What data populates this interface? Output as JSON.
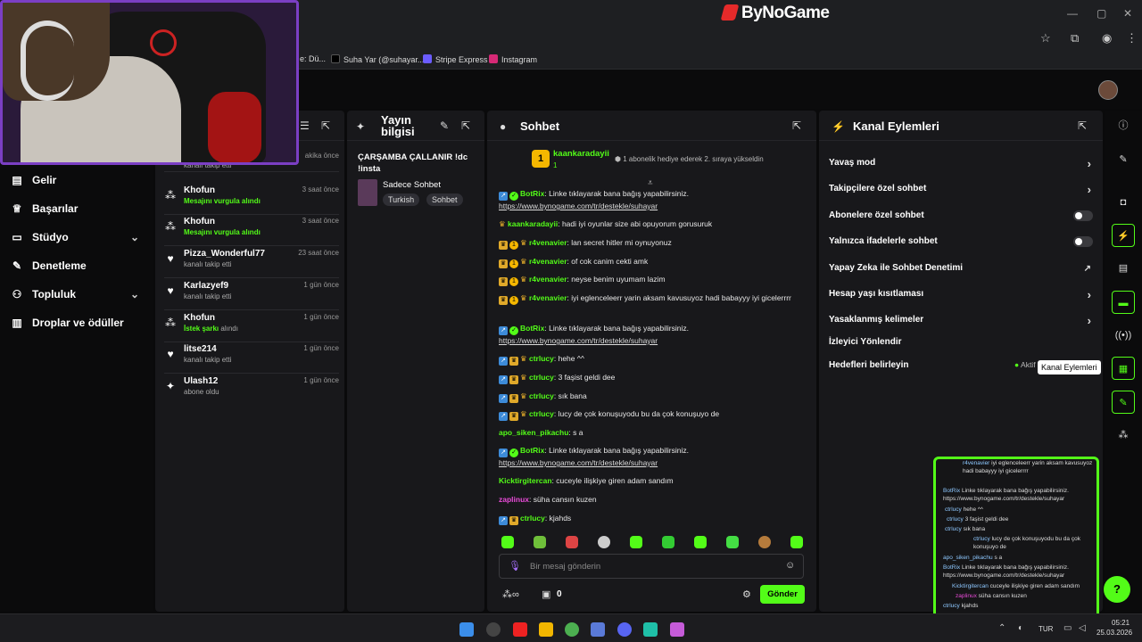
{
  "browser": {
    "brand": "ByNoGame",
    "bookmarks": [
      {
        "label": "e: Dü..."
      },
      {
        "label": "Suha Yar (@suhayar...",
        "icon": "tiktok-icon"
      },
      {
        "label": "Stripe Express",
        "icon": "stripe-icon"
      },
      {
        "label": "Instagram",
        "icon": "instagram-icon"
      }
    ]
  },
  "sidebar": {
    "items": [
      {
        "label": "Gelir",
        "icon": "wallet-icon"
      },
      {
        "label": "Başarılar",
        "icon": "trophy-icon"
      },
      {
        "label": "Stüdyo",
        "icon": "studio-icon"
      },
      {
        "label": "Denetleme",
        "icon": "wrench-icon"
      },
      {
        "label": "Topluluk",
        "icon": "people-icon"
      },
      {
        "label": "Droplar ve ödüller",
        "icon": "drops-icon"
      }
    ]
  },
  "events": {
    "partial_top": {
      "time": "akika önce",
      "desc": "kanalı takip etti"
    },
    "items": [
      {
        "name": "Khofun",
        "time": "3 saat önce",
        "desc": "Mesajını vurgula alındı",
        "icon": "points-icon",
        "highlight": true
      },
      {
        "name": "Khofun",
        "time": "3 saat önce",
        "desc": "Mesajını vurgula alındı",
        "icon": "points-icon",
        "highlight": true
      },
      {
        "name": "Pizza_Wonderful77",
        "time": "23 saat önce",
        "desc": "kanalı takip etti",
        "icon": "heart-icon",
        "highlight": false
      },
      {
        "name": "Karlazyef9",
        "time": "1 gün önce",
        "desc": "kanalı takip etti",
        "icon": "heart-icon",
        "highlight": false
      },
      {
        "name": "Khofun",
        "time": "1 gün önce",
        "desc_hl": "İstek şarkı",
        "desc_rest": "alındı",
        "icon": "points-icon",
        "highlight": true
      },
      {
        "name": "litse214",
        "time": "1 gün önce",
        "desc": "kanalı takip etti",
        "icon": "heart-icon",
        "highlight": false
      },
      {
        "name": "Ulash12",
        "time": "1 gün önce",
        "desc": "abone oldu",
        "icon": "sparkle-icon",
        "highlight": false
      }
    ]
  },
  "stream_info": {
    "title": "Yayın bilgisi",
    "stream_title": "ÇARŞAMBA ÇALLANIR !dc !insta",
    "category": "Sadece Sohbet",
    "tags": [
      "Turkish",
      "Sohbet"
    ]
  },
  "chat": {
    "title": "Sohbet",
    "pinned": {
      "user": "kaankaradayii",
      "rank": "1",
      "count": "1",
      "text": "1 abonelik hediye ederek 2. sıraya yükseldin"
    },
    "messages": [
      {
        "user": "BotRix",
        "color": "#53fc18",
        "badges": [
          "blue",
          "ver"
        ],
        "text": "Linke tıklayarak bana bağış yapabilirsiniz.",
        "link": "https://www.bynogame.com/tr/destekle/suhayar"
      },
      {
        "user": "kaankaradayii",
        "color": "#53fc18",
        "badges": [
          "crown"
        ],
        "text": "hadi iyi oyunlar size abi opuyorum gorusuruk"
      },
      {
        "user": "r4venavier",
        "color": "#53fc18",
        "badges": [
          "crown2",
          "gold",
          "crown"
        ],
        "text": "lan secret hitler mi oynuyonuz"
      },
      {
        "user": "r4venavier",
        "color": "#53fc18",
        "badges": [
          "crown2",
          "gold",
          "crown"
        ],
        "text": "of cok canim cekti amk"
      },
      {
        "user": "r4venavier",
        "color": "#53fc18",
        "badges": [
          "crown2",
          "gold",
          "crown"
        ],
        "text": "neyse benim uyumam lazim"
      },
      {
        "user": "r4venavier",
        "color": "#53fc18",
        "badges": [
          "crown2",
          "gold",
          "crown"
        ],
        "text": "iyi eglenceleerr yarin aksam kavusuyoz hadi babayyy iyi gicelerrrr"
      },
      {
        "user": "BotRix",
        "color": "#53fc18",
        "badges": [
          "blue",
          "ver"
        ],
        "text": "Linke tıklayarak bana bağış yapabilirsiniz.",
        "link": "https://www.bynogame.com/tr/destekle/suhayar"
      },
      {
        "user": "ctrlucy",
        "color": "#53fc18",
        "badges": [
          "blue",
          "crown2",
          "crown"
        ],
        "text": "hehe ^^"
      },
      {
        "user": "ctrlucy",
        "color": "#53fc18",
        "badges": [
          "blue",
          "crown2",
          "crown"
        ],
        "text": "3 faşist geldi dee"
      },
      {
        "user": "ctrlucy",
        "color": "#53fc18",
        "badges": [
          "blue",
          "crown2",
          "crown"
        ],
        "text": "sık bana"
      },
      {
        "user": "ctrlucy",
        "color": "#53fc18",
        "badges": [
          "blue",
          "crown2",
          "crown"
        ],
        "text": "lucy de çok konuşuyodu bu da çok konuşuyo de"
      },
      {
        "user": "apo_siken_pikachu",
        "color": "#53fc18",
        "badges": [],
        "text": "s a"
      },
      {
        "user": "BotRix",
        "color": "#53fc18",
        "badges": [
          "blue",
          "ver"
        ],
        "text": "Linke tıklayarak bana bağış yapabilirsiniz.",
        "link": "https://www.bynogame.com/tr/destekle/suhayar"
      },
      {
        "user": "Kicktirgitercan",
        "color": "#53fc18",
        "badges": [],
        "text": "cuceyle ilişkiye giren adam sandım"
      },
      {
        "user": "zaplinux",
        "color": "#e94bd8",
        "badges": [],
        "text": "süha cansın kuzen"
      },
      {
        "user": "ctrlucy",
        "color": "#53fc18",
        "badges": [
          "blue",
          "crown2"
        ],
        "text": "kjahds"
      }
    ],
    "input_placeholder": "Bir mesaj gönderin",
    "points": "0",
    "send_label": "Gönder"
  },
  "actions": {
    "title": "Kanal Eylemleri",
    "items": [
      {
        "label": "Yavaş mod",
        "kind": "arrow"
      },
      {
        "label": "Takipçilere özel sohbet",
        "kind": "arrow"
      },
      {
        "label": "Abonelere özel sohbet",
        "kind": "toggle"
      },
      {
        "label": "Yalnızca ifadelerle sohbet",
        "kind": "toggle"
      },
      {
        "label": "Yapay Zeka ile Sohbet Denetimi",
        "kind": "external"
      },
      {
        "label": "Hesap yaşı kısıtlaması",
        "kind": "arrow"
      },
      {
        "label": "Yasaklanmış kelimeler",
        "kind": "arrow"
      },
      {
        "label": "İzleyici Yönlendir",
        "kind": "none"
      },
      {
        "label": "Hedefleri belirleyin",
        "kind": "status",
        "status": "Aktif"
      }
    ],
    "tooltip": "Kanal Eylemleri"
  },
  "overlay_chat": [
    {
      "user": "r4venavier",
      "text": "iyi eglenceleerr yarin aksam kavusuyoz hadi babayyy iyi gicelerrrr"
    },
    {
      "user": "BotRix",
      "text": "Linke tıklayarak bana bağış yapabilirsiniz. https://www.bynogame.com/tr/destekle/suhayar"
    },
    {
      "user": "ctrlucy",
      "text": "hehe ^^"
    },
    {
      "user": "ctrlucy",
      "text": "3 faşist geldi dee"
    },
    {
      "user": "ctrlucy",
      "text": "sık bana"
    },
    {
      "user": "ctrlucy",
      "text": "lucy de çok konuşuyodu bu da çok konuşuyo de"
    },
    {
      "user": "apo_siken_pikachu",
      "text": "s a"
    },
    {
      "user": "BotRix",
      "text": "Linke tıklayarak bana bağış yapabilirsiniz. https://www.bynogame.com/tr/destekle/suhayar"
    },
    {
      "user": "Kicktirgitercan",
      "text": "cuceyle ilişkiye giren adam sandım"
    },
    {
      "user": "zaplinux",
      "text": "süha cansın kuzen"
    },
    {
      "user": "ctrlucy",
      "text": "kjahds"
    }
  ],
  "taskbar": {
    "lang": "TUR",
    "time": "05:21",
    "date": "25.03.2026"
  },
  "colors": {
    "accent": "#53fc18",
    "panel": "#18181b",
    "bg": "#0a0a0b",
    "webcam_border": "#7b3fc4"
  }
}
